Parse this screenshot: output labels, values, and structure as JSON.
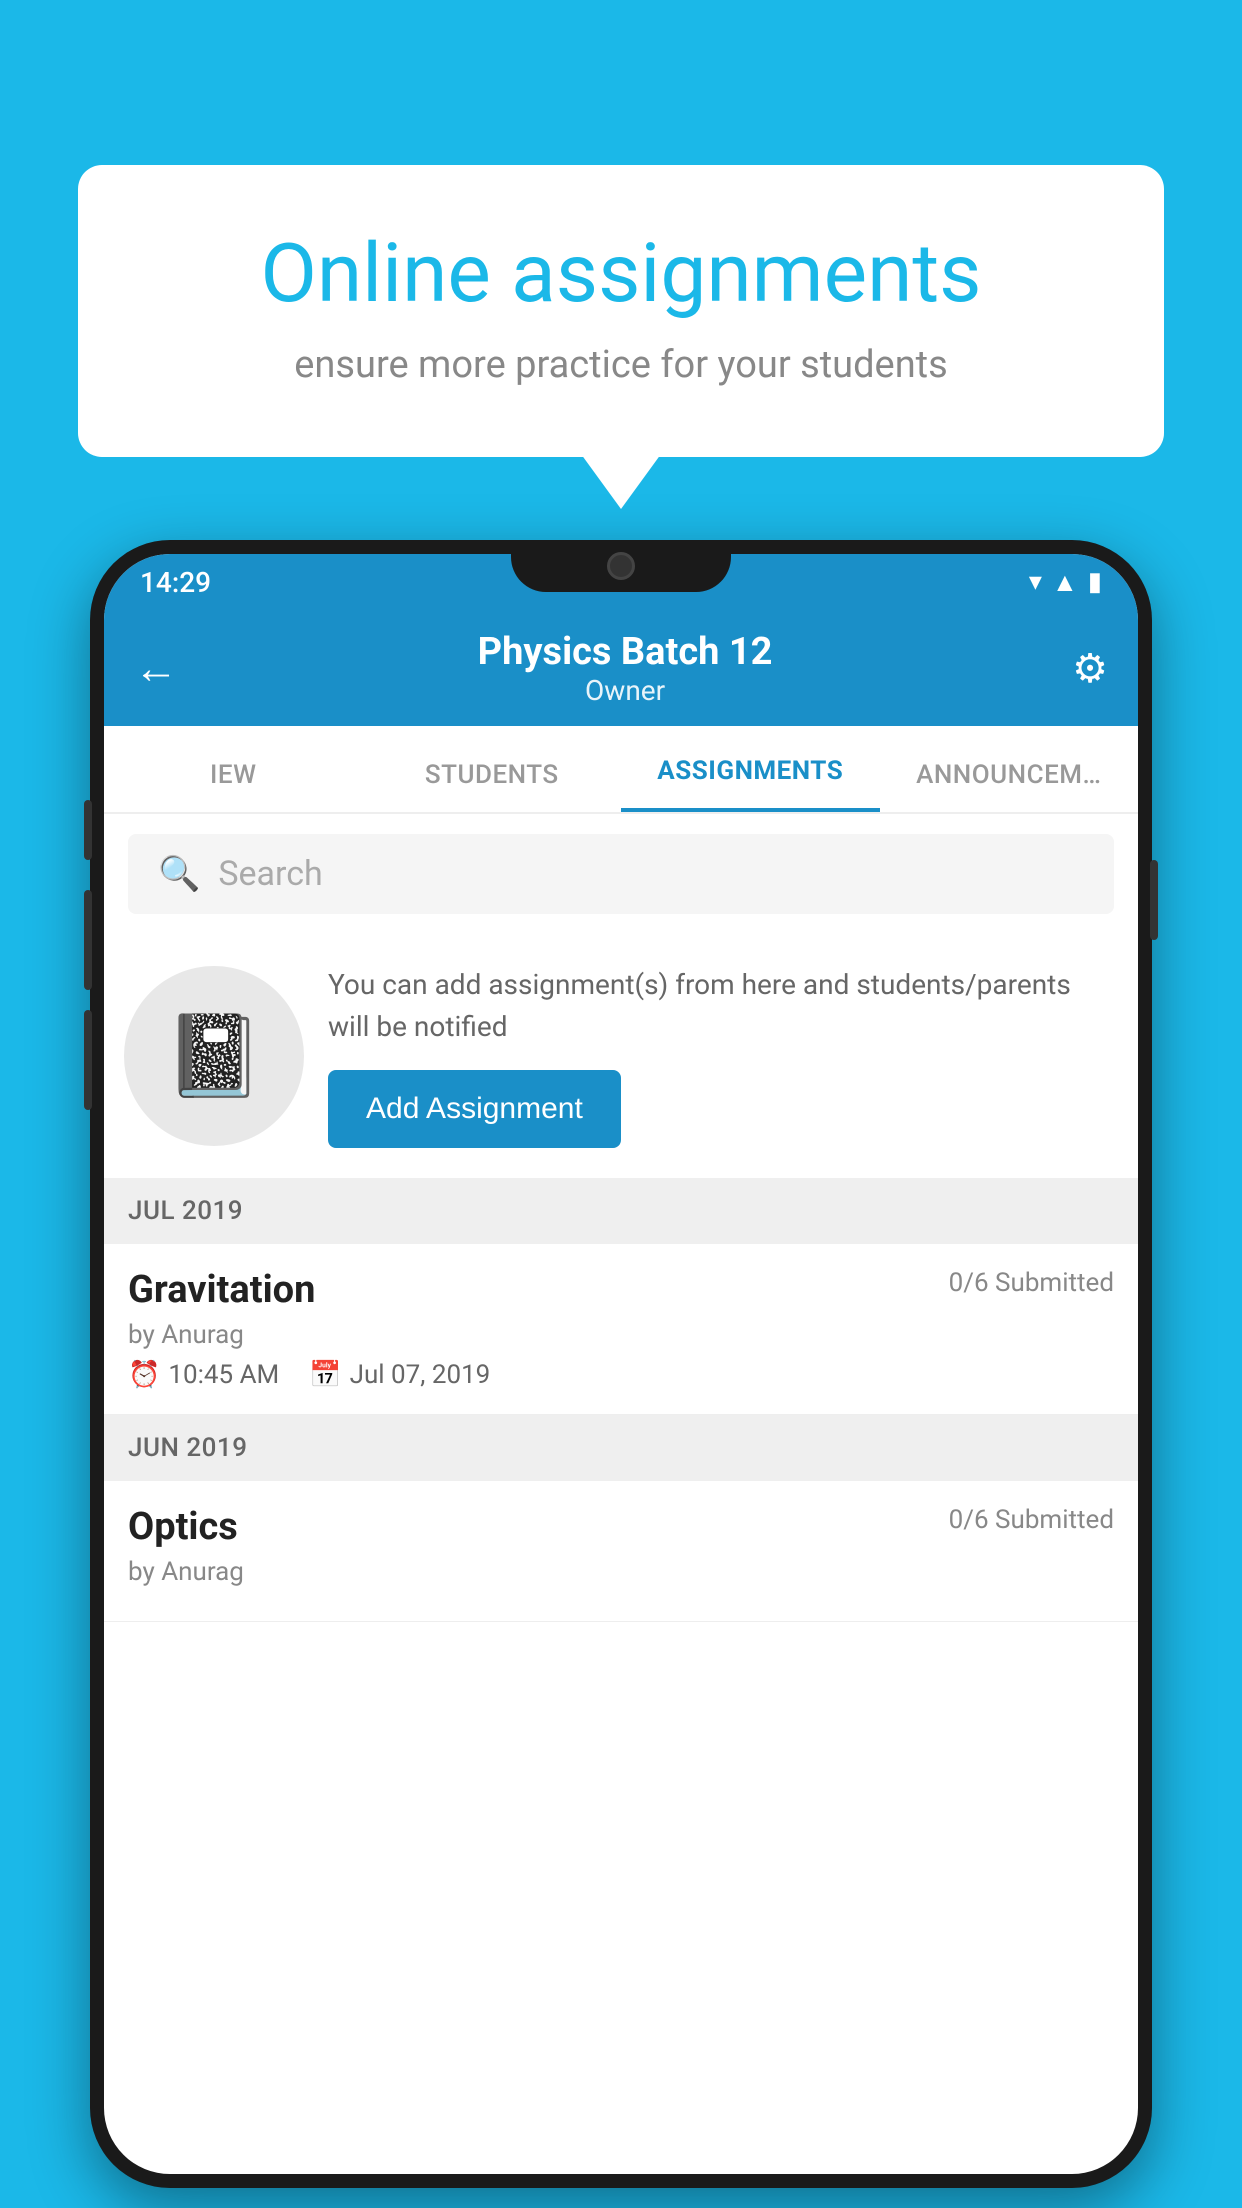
{
  "background_color": "#1BB8E8",
  "speech_bubble": {
    "title": "Online assignments",
    "subtitle": "ensure more practice for your students"
  },
  "phone": {
    "status_bar": {
      "time": "14:29",
      "icons": [
        "wifi",
        "signal",
        "battery"
      ]
    },
    "header": {
      "title": "Physics Batch 12",
      "subtitle": "Owner",
      "back_label": "←",
      "settings_label": "⚙"
    },
    "tabs": [
      {
        "label": "IEW",
        "active": false
      },
      {
        "label": "STUDENTS",
        "active": false
      },
      {
        "label": "ASSIGNMENTS",
        "active": true
      },
      {
        "label": "ANNOUNCEM…",
        "active": false
      }
    ],
    "search": {
      "placeholder": "Search"
    },
    "add_assignment_section": {
      "description": "You can add assignment(s) from here and students/parents will be notified",
      "button_label": "Add Assignment"
    },
    "sections": [
      {
        "header": "JUL 2019",
        "items": [
          {
            "name": "Gravitation",
            "submitted": "0/6 Submitted",
            "by": "by Anurag",
            "time": "10:45 AM",
            "date": "Jul 07, 2019"
          }
        ]
      },
      {
        "header": "JUN 2019",
        "items": [
          {
            "name": "Optics",
            "submitted": "0/6 Submitted",
            "by": "by Anurag",
            "time": "",
            "date": ""
          }
        ]
      }
    ]
  }
}
